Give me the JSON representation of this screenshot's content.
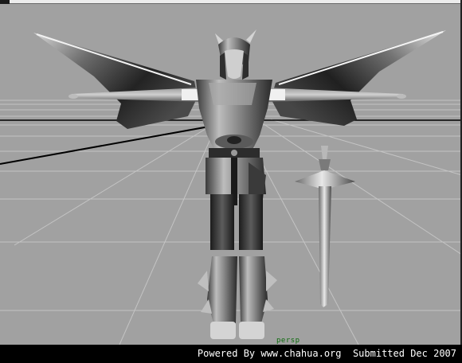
{
  "viewport": {
    "camera_label": "persp",
    "background_color": "#a1a1a1",
    "grid_color": "#c4c4c4",
    "axis_color": "#000000"
  },
  "scene": {
    "model": "winged-armored-warrior",
    "pose": "t-pose",
    "props": [
      "sword"
    ]
  },
  "footer": {
    "credit_text": "Powered By www.chahua.org  Submitted Dec 2007"
  }
}
